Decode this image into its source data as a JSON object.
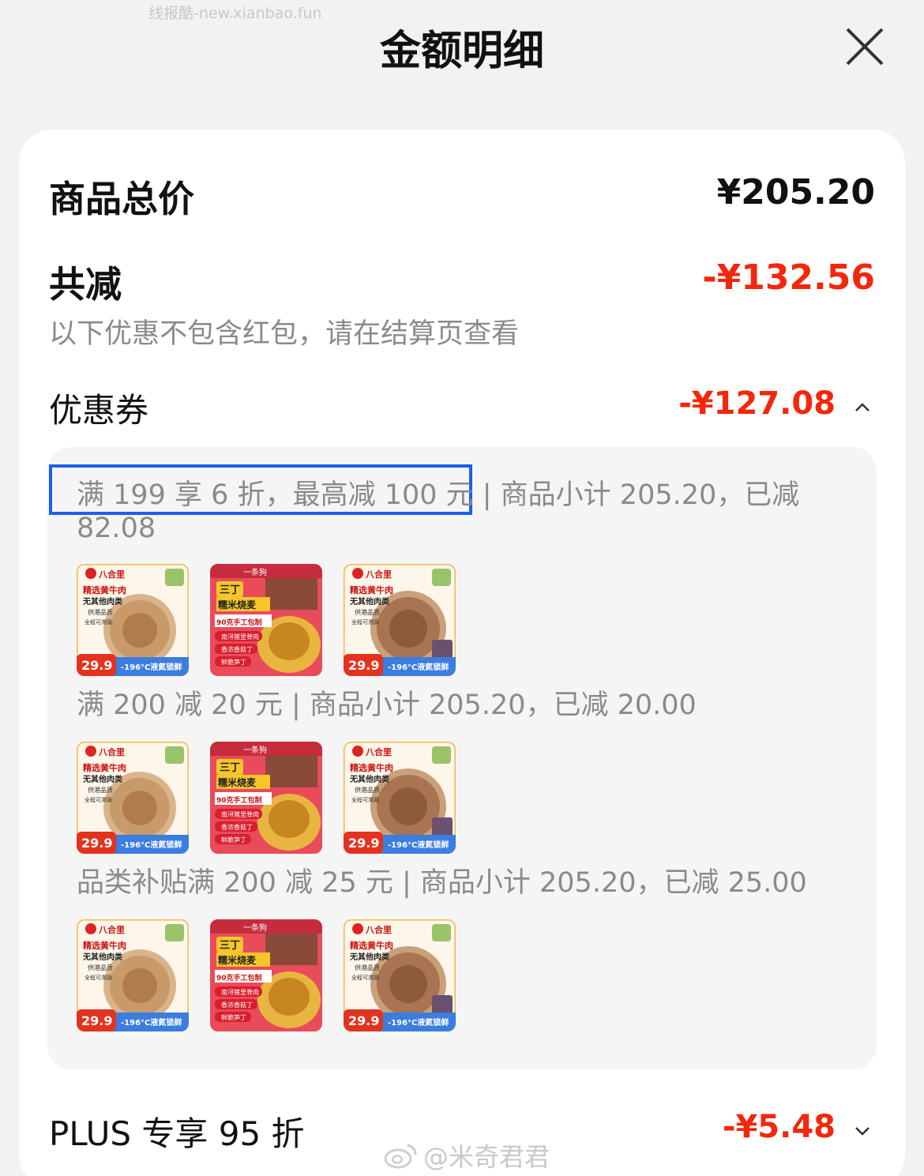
{
  "watermark_top": "线报酷-new.xianbao.fun",
  "header": {
    "title": "金额明细"
  },
  "summary": {
    "total_label": "商品总价",
    "total_value": "¥205.20",
    "reduce_label": "共减",
    "reduce_value": "-¥132.56",
    "note": "以下优惠不包含红包，请在结算页查看"
  },
  "coupon": {
    "label": "优惠券",
    "value": "-¥127.08",
    "expanded": true,
    "items": [
      {
        "desc": "满 199 享 6 折，最高减 100 元 | 商品小计 205.20，已减 82.08"
      },
      {
        "desc": "满 200 减 20 元 | 商品小计 205.20，已减 20.00"
      },
      {
        "desc": "品类补贴满 200 减 25 元 | 商品小计 205.20，已减 25.00"
      }
    ]
  },
  "product_a": {
    "brand": "八合里",
    "line1": "精选黄牛肉",
    "line2": "无其他肉类",
    "line3": "供港品质",
    "line4": "全程可溯源",
    "price": "29.9",
    "tag": "-196°C液氮锁鲜"
  },
  "product_b": {
    "brand": "一条狗",
    "tag": "三丁",
    "title": "糯米烧麦",
    "sub": "90克手工包制",
    "b1": "南浔猪里脊肉",
    "b2": "香浓香菇丁",
    "b3": "鲜脆笋丁"
  },
  "plus": {
    "label": "PLUS 专享 95 折",
    "value": "-¥5.48"
  },
  "watermark_bottom": "@米奇君君",
  "colors": {
    "accent_red": "#f2270c",
    "selection_blue": "#1a5ff0"
  }
}
